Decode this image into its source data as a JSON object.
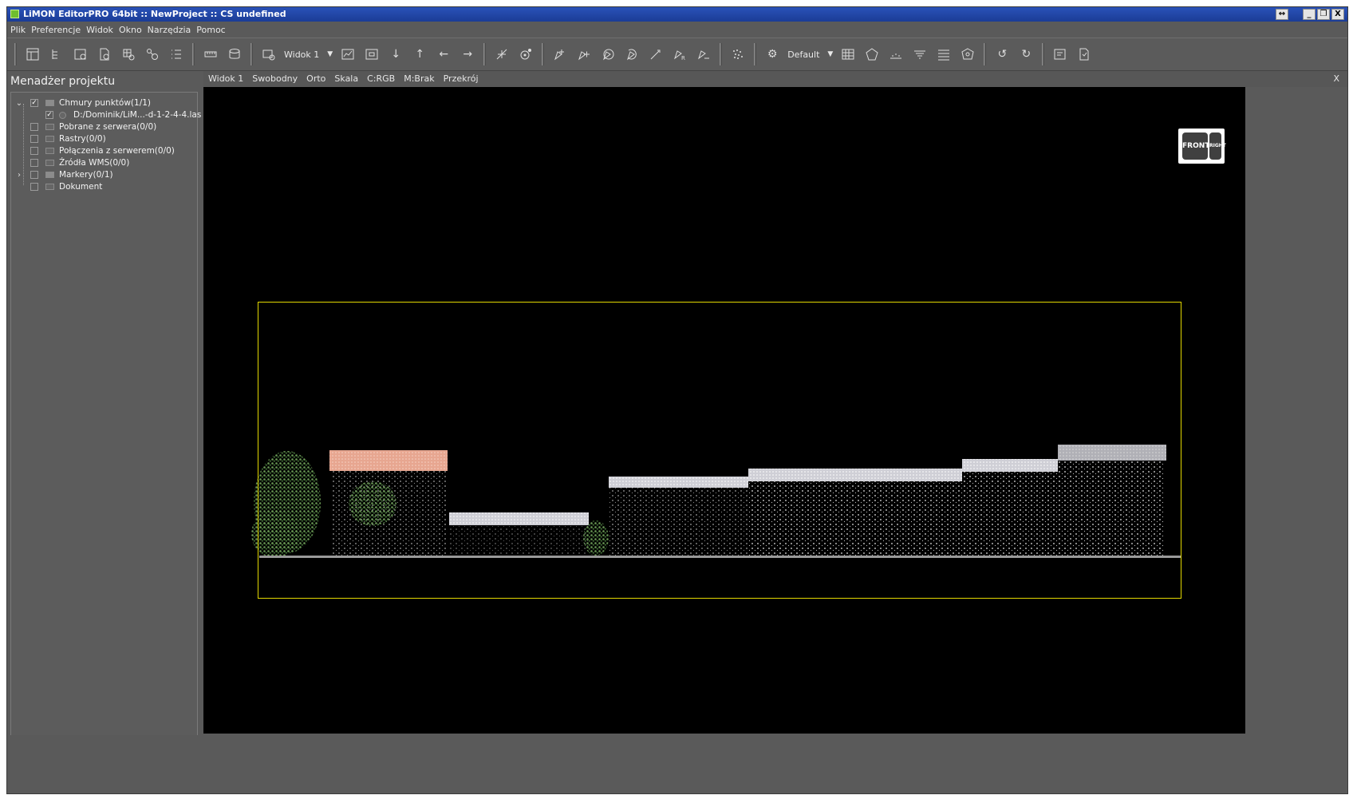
{
  "window": {
    "title": "LiMON EditorPRO 64bit :: NewProject :: CS undefined",
    "buttons": [
      "↔",
      "_",
      "❐",
      "X"
    ]
  },
  "menu": [
    "Plik",
    "Preferencje",
    "Widok",
    "Okno",
    "Narzędzia",
    "Pomoc"
  ],
  "toolbar": {
    "view_combo": "Widok 1",
    "style_combo": "Default"
  },
  "sidebar": {
    "title": "Menadżer projektu",
    "tree": [
      {
        "label": "Chmury punktów(1/1)",
        "checked": true,
        "expanded": true
      },
      {
        "label": "D:/Dominik/LiM...-d-1-2-4-4.las",
        "checked": true
      },
      {
        "label": "Pobrane z serwera(0/0)",
        "checked": false
      },
      {
        "label": "Rastry(0/0)",
        "checked": false
      },
      {
        "label": "Połączenia z serwerem(0/0)",
        "checked": false
      },
      {
        "label": "Źródła WMS(0/0)",
        "checked": false
      },
      {
        "label": "Markery(0/1)",
        "checked": false,
        "collapsed": true
      },
      {
        "label": "Dokument",
        "checked": false
      }
    ]
  },
  "view": {
    "tabs": [
      "Widok 1",
      "Swobodny",
      "Orto",
      "Skala",
      "C:RGB",
      "M:Brak",
      "Przekrój"
    ],
    "close": "X",
    "cube": {
      "front": "FRONT",
      "right": "RIGHT"
    },
    "bbox_color": "#e3d800"
  }
}
